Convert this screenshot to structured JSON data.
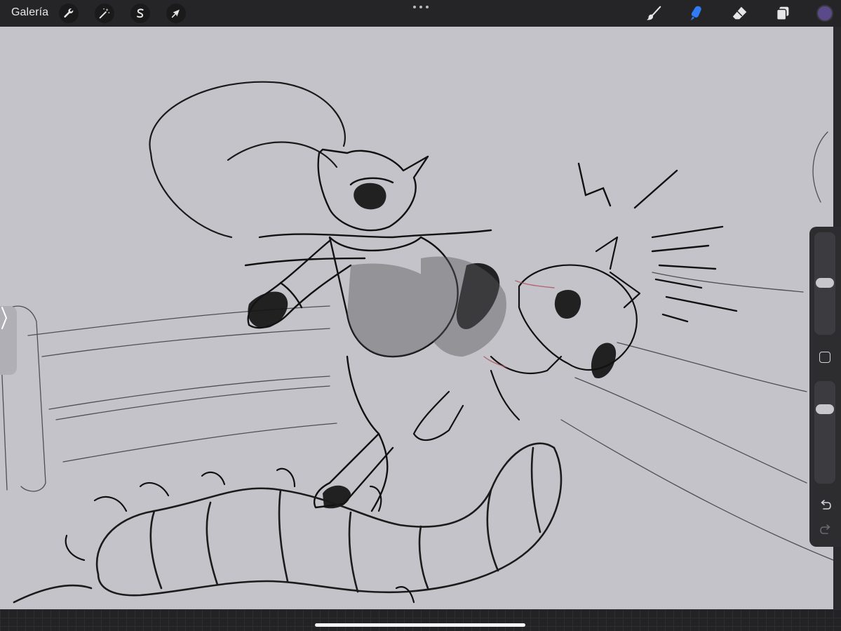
{
  "app": {
    "gallery_label": "Galería"
  },
  "toolbar": {
    "left_tools": [
      {
        "name": "actions",
        "icon": "wrench-icon"
      },
      {
        "name": "adjustments",
        "icon": "magic-wand-icon"
      },
      {
        "name": "selection",
        "icon": "selection-s-icon"
      },
      {
        "name": "transform",
        "icon": "arrow-cursor-icon"
      }
    ],
    "right_tools": [
      {
        "name": "brush",
        "icon": "brush-icon",
        "active": false
      },
      {
        "name": "smudge",
        "icon": "smudge-icon",
        "active": true
      },
      {
        "name": "eraser",
        "icon": "eraser-icon",
        "active": false
      },
      {
        "name": "layers",
        "icon": "layers-icon",
        "active": false
      }
    ],
    "current_color": "#5a4a8a"
  },
  "colors": {
    "toolbar_bg": "#252527",
    "canvas_bg": "#c4c3c9",
    "active_tool": "#2f7cf6",
    "sketch_ink": "#141414"
  },
  "sidebar": {
    "brush_size_level": 0.22,
    "opacity_level": 0.25
  }
}
